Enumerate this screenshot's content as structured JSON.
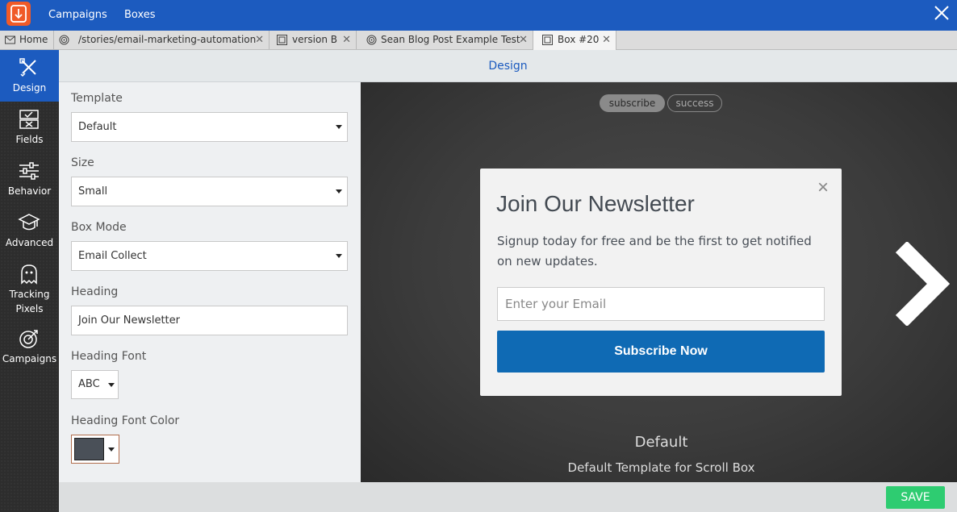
{
  "topbar": {
    "nav": [
      "Campaigns",
      "Boxes"
    ]
  },
  "tabs": [
    {
      "label": "Home",
      "icon": "mail-icon"
    },
    {
      "label": "/stories/email-marketing-automation",
      "icon": "target-icon"
    },
    {
      "label": "version B",
      "icon": "box-icon"
    },
    {
      "label": "Sean Blog Post Example Test",
      "icon": "target-icon"
    },
    {
      "label": "Box #20",
      "icon": "box-icon"
    }
  ],
  "sidebar": {
    "items": [
      {
        "label": "Design",
        "icon": "design-tools-icon",
        "active": true
      },
      {
        "label": "Fields",
        "icon": "fields-icon"
      },
      {
        "label": "Behavior",
        "icon": "sliders-icon"
      },
      {
        "label": "Advanced",
        "icon": "graduation-cap-icon"
      },
      {
        "label": "Tracking",
        "label2": "Pixels",
        "icon": "ghost-icon"
      },
      {
        "label": "Campaigns",
        "icon": "target-icon"
      }
    ]
  },
  "header": {
    "title": "Design"
  },
  "form": {
    "template": {
      "label": "Template",
      "value": "Default"
    },
    "size": {
      "label": "Size",
      "value": "Small"
    },
    "box_mode": {
      "label": "Box Mode",
      "value": "Email Collect"
    },
    "heading": {
      "label": "Heading",
      "value": "Join Our Newsletter"
    },
    "heading_font": {
      "label": "Heading Font",
      "value": "ABC"
    },
    "heading_font_color": {
      "label": "Heading Font Color",
      "value": "#4a5058"
    }
  },
  "preview": {
    "states": [
      "subscribe",
      "success"
    ],
    "active_state": "subscribe",
    "modal": {
      "heading": "Join Our Newsletter",
      "text": "Signup today for free and be the first to get notified on new updates.",
      "email_placeholder": "Enter your Email",
      "button": "Subscribe Now",
      "close": "×"
    },
    "template_name": "Default",
    "template_desc": "Default Template for Scroll Box"
  },
  "footer": {
    "save": "SAVE"
  },
  "colors": {
    "brand": "#1c5bbf",
    "accent": "#f05a28",
    "button": "#0f6ab4",
    "save": "#2ecc71"
  }
}
